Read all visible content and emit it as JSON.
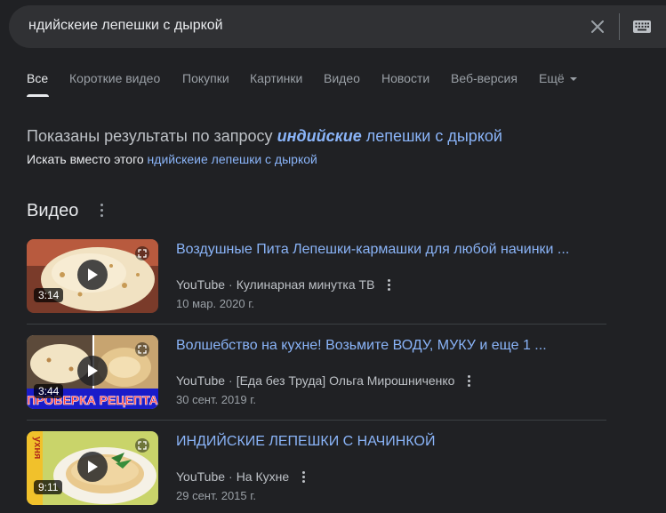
{
  "search": {
    "query": "ндийскеие лепешки с дыркой"
  },
  "tabs": [
    {
      "label": "Все",
      "active": true
    },
    {
      "label": "Короткие видео"
    },
    {
      "label": "Покупки"
    },
    {
      "label": "Картинки"
    },
    {
      "label": "Видео"
    },
    {
      "label": "Новости"
    },
    {
      "label": "Веб-версия"
    },
    {
      "label": "Ещё"
    }
  ],
  "correction": {
    "prefix": "Показаны результаты по запросу",
    "corrected_word": "индийские",
    "rest": "лепешки с дыркой",
    "instead_prefix": "Искать вместо этого",
    "instead_query": "ндийскеие лепешки с дыркой"
  },
  "videos_section": {
    "title": "Видео",
    "items": [
      {
        "title": "Воздушные Пита Лепешки-кармашки для любой начинки ...",
        "source": "YouTube",
        "channel": "Кулинарная минутка ТВ",
        "date": "10 мар. 2020 г.",
        "duration": "3:14"
      },
      {
        "title": "Волшебство на кухне! Возьмите ВОДУ, МУКУ и еще 1 ...",
        "source": "YouTube",
        "channel": "[Еда без Труда] Ольга Мирошниченко",
        "date": "30 сент. 2019 г.",
        "duration": "3:44",
        "banner": "ПРОВЕРКА РЕЦЕПТА"
      },
      {
        "title": "ИНДИЙСКИЕ ЛЕПЕШКИ С НАЧИНКОЙ",
        "source": "YouTube",
        "channel": "На Кухне",
        "date": "29 сент. 2015 г.",
        "duration": "9:11",
        "side_label": "ухня"
      }
    ]
  },
  "colors": {
    "background": "#202124",
    "link": "#8ab4f8",
    "text": "#bdc1c6",
    "search_bg": "#303134"
  }
}
